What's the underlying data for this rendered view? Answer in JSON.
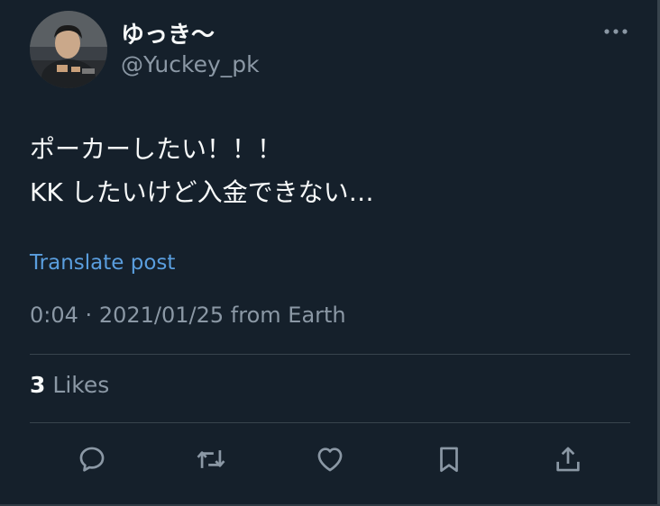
{
  "user": {
    "display_name": "ゆっき〜",
    "handle": "@Yuckey_pk",
    "avatar_icon": "profile-photo"
  },
  "tweet": {
    "lines": [
      "ポーカーしたい！！！",
      "KK したいけど入金できない…"
    ]
  },
  "translate_label": "Translate post",
  "meta": {
    "time": "0:04",
    "separator": "·",
    "date": "2021/01/25",
    "source": "from Earth"
  },
  "stats": {
    "likes_count": "3",
    "likes_label": "Likes"
  },
  "actions": [
    {
      "icon": "reply-icon"
    },
    {
      "icon": "retweet-icon"
    },
    {
      "icon": "heart-icon"
    },
    {
      "icon": "bookmark-icon"
    },
    {
      "icon": "share-icon"
    }
  ],
  "colors": {
    "background": "#15202b",
    "text": "#f7f9f9",
    "muted": "#8b98a5",
    "link": "#5a9ede",
    "divider": "#38444d"
  }
}
